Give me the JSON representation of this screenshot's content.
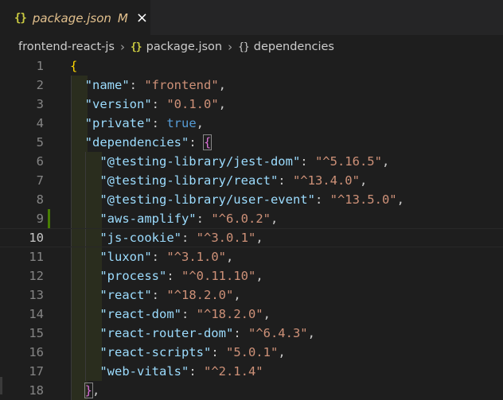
{
  "tab": {
    "icon": "json-braces-icon",
    "title": "package.json",
    "modified_badge": "M",
    "close": "×"
  },
  "breadcrumb": {
    "folder": "frontend-react-js",
    "file": "package.json",
    "symbol": "dependencies",
    "json_icon_glyph": "{}",
    "object_icon_glyph": "{}",
    "separator": "›"
  },
  "editor": {
    "current_line": 10,
    "modified_line": 9,
    "colors": {
      "key": "#9cdcfe",
      "string": "#ce9178",
      "boolean": "#569cd6",
      "brace_level1": "#ffd700",
      "brace_level2": "#da70d6",
      "gutter_modified": "#487e02"
    },
    "lines": [
      {
        "n": "1",
        "indent": "",
        "tokens": [
          [
            "brace1",
            "{"
          ]
        ]
      },
      {
        "n": "2",
        "indent": "  ",
        "tokens": [
          [
            "key",
            "\"name\""
          ],
          [
            "punc",
            ": "
          ],
          [
            "str",
            "\"frontend\""
          ],
          [
            "punc",
            ","
          ]
        ]
      },
      {
        "n": "3",
        "indent": "  ",
        "tokens": [
          [
            "key",
            "\"version\""
          ],
          [
            "punc",
            ": "
          ],
          [
            "str",
            "\"0.1.0\""
          ],
          [
            "punc",
            ","
          ]
        ]
      },
      {
        "n": "4",
        "indent": "  ",
        "tokens": [
          [
            "key",
            "\"private\""
          ],
          [
            "punc",
            ": "
          ],
          [
            "bool",
            "true"
          ],
          [
            "punc",
            ","
          ]
        ]
      },
      {
        "n": "5",
        "indent": "  ",
        "tokens": [
          [
            "key",
            "\"dependencies\""
          ],
          [
            "punc",
            ": "
          ],
          [
            "brace2box",
            "{"
          ]
        ]
      },
      {
        "n": "6",
        "indent": "    ",
        "tokens": [
          [
            "key",
            "\"@testing-library/jest-dom\""
          ],
          [
            "punc",
            ": "
          ],
          [
            "str",
            "\"^5.16.5\""
          ],
          [
            "punc",
            ","
          ]
        ]
      },
      {
        "n": "7",
        "indent": "    ",
        "tokens": [
          [
            "key",
            "\"@testing-library/react\""
          ],
          [
            "punc",
            ": "
          ],
          [
            "str",
            "\"^13.4.0\""
          ],
          [
            "punc",
            ","
          ]
        ]
      },
      {
        "n": "8",
        "indent": "    ",
        "tokens": [
          [
            "key",
            "\"@testing-library/user-event\""
          ],
          [
            "punc",
            ": "
          ],
          [
            "str",
            "\"^13.5.0\""
          ],
          [
            "punc",
            ","
          ]
        ]
      },
      {
        "n": "9",
        "indent": "    ",
        "tokens": [
          [
            "key",
            "\"aws-amplify\""
          ],
          [
            "punc",
            ": "
          ],
          [
            "str",
            "\"^6.0.2\""
          ],
          [
            "punc",
            ","
          ]
        ]
      },
      {
        "n": "10",
        "indent": "    ",
        "tokens": [
          [
            "key",
            "\"js-cookie\""
          ],
          [
            "punc",
            ": "
          ],
          [
            "str",
            "\"^3.0.1\""
          ],
          [
            "punc",
            ","
          ]
        ]
      },
      {
        "n": "11",
        "indent": "    ",
        "tokens": [
          [
            "key",
            "\"luxon\""
          ],
          [
            "punc",
            ": "
          ],
          [
            "str",
            "\"^3.1.0\""
          ],
          [
            "punc",
            ","
          ]
        ]
      },
      {
        "n": "12",
        "indent": "    ",
        "tokens": [
          [
            "key",
            "\"process\""
          ],
          [
            "punc",
            ": "
          ],
          [
            "str",
            "\"^0.11.10\""
          ],
          [
            "punc",
            ","
          ]
        ]
      },
      {
        "n": "13",
        "indent": "    ",
        "tokens": [
          [
            "key",
            "\"react\""
          ],
          [
            "punc",
            ": "
          ],
          [
            "str",
            "\"^18.2.0\""
          ],
          [
            "punc",
            ","
          ]
        ]
      },
      {
        "n": "14",
        "indent": "    ",
        "tokens": [
          [
            "key",
            "\"react-dom\""
          ],
          [
            "punc",
            ": "
          ],
          [
            "str",
            "\"^18.2.0\""
          ],
          [
            "punc",
            ","
          ]
        ]
      },
      {
        "n": "15",
        "indent": "    ",
        "tokens": [
          [
            "key",
            "\"react-router-dom\""
          ],
          [
            "punc",
            ": "
          ],
          [
            "str",
            "\"^6.4.3\""
          ],
          [
            "punc",
            ","
          ]
        ]
      },
      {
        "n": "16",
        "indent": "    ",
        "tokens": [
          [
            "key",
            "\"react-scripts\""
          ],
          [
            "punc",
            ": "
          ],
          [
            "str",
            "\"5.0.1\""
          ],
          [
            "punc",
            ","
          ]
        ]
      },
      {
        "n": "17",
        "indent": "    ",
        "tokens": [
          [
            "key",
            "\"web-vitals\""
          ],
          [
            "punc",
            ": "
          ],
          [
            "str",
            "\"^2.1.4\""
          ]
        ]
      },
      {
        "n": "18",
        "indent": "  ",
        "tokens": [
          [
            "brace2box",
            "}"
          ],
          [
            "punc",
            ","
          ]
        ]
      }
    ]
  }
}
